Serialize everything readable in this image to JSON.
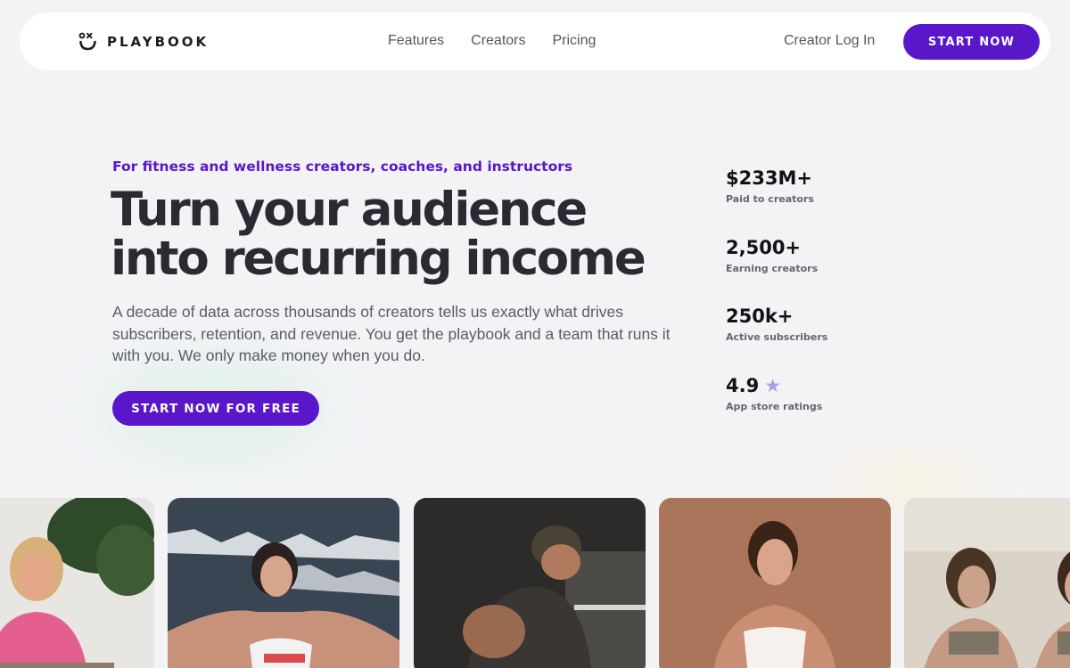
{
  "brand": {
    "name": "PLAYBOOK",
    "logo_icon": "smile-x-icon"
  },
  "nav": {
    "links": [
      "Features",
      "Creators",
      "Pricing"
    ],
    "login_label": "Creator Log In",
    "start_label": "START NOW"
  },
  "hero": {
    "eyebrow": "For fitness and wellness creators, coaches, and instructors",
    "headline_line1": "Turn your audience",
    "headline_line2": "into recurring income",
    "subcopy": "A decade of data across thousands of creators tells us exactly what drives subscribers, retention, and revenue. You get the playbook and a team that runs it with you. We only make money when you do.",
    "cta_label": "START NOW FOR FREE"
  },
  "stats": [
    {
      "value": "$233M+",
      "label": "Paid to creators"
    },
    {
      "value": "2,500+",
      "label": "Earning creators"
    },
    {
      "value": "250k+",
      "label": "Active subscribers"
    },
    {
      "value": "4.9",
      "label": "App store ratings",
      "icon": "star-icon"
    }
  ],
  "colors": {
    "accent": "#5a16c9",
    "background": "#f3f3f6",
    "text": "#2a2a33",
    "star": "#b49ae6"
  },
  "photos": [
    {
      "name": "creator-photo-1"
    },
    {
      "name": "creator-photo-2"
    },
    {
      "name": "creator-photo-3"
    },
    {
      "name": "creator-photo-4"
    },
    {
      "name": "creator-photo-5"
    }
  ]
}
